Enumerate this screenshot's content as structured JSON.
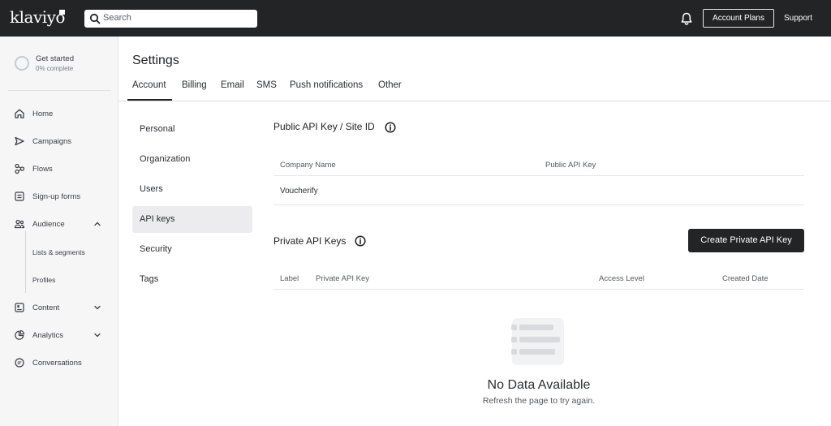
{
  "topbar": {
    "logo": "klaviyo",
    "search_placeholder": "Search",
    "account_plans": "Account Plans",
    "support": "Support"
  },
  "sidebar": {
    "get_started": {
      "title": "Get started",
      "progress": "0% complete"
    },
    "items": [
      {
        "label": "Home",
        "icon": "home-icon"
      },
      {
        "label": "Campaigns",
        "icon": "send-icon"
      },
      {
        "label": "Flows",
        "icon": "flows-icon"
      },
      {
        "label": "Sign-up forms",
        "icon": "form-icon"
      },
      {
        "label": "Audience",
        "icon": "people-icon",
        "expanded": true
      },
      {
        "label": "Content",
        "icon": "content-icon"
      },
      {
        "label": "Analytics",
        "icon": "chart-icon"
      },
      {
        "label": "Conversations",
        "icon": "chat-icon"
      }
    ],
    "audience_sub": [
      "Lists & segments",
      "Profiles"
    ]
  },
  "header": {
    "title": "Settings",
    "tabs": [
      "Account",
      "Billing",
      "Email",
      "SMS",
      "Push notifications",
      "Other"
    ],
    "active_tab": "Account"
  },
  "subnav": {
    "items": [
      "Personal",
      "Organization",
      "Users",
      "API keys",
      "Security",
      "Tags"
    ],
    "active": "API keys"
  },
  "public_api": {
    "title": "Public API Key / Site ID",
    "columns": [
      "Company Name",
      "Public API Key"
    ],
    "rows": [
      {
        "company": "Voucherify",
        "key": ""
      }
    ]
  },
  "private_api": {
    "title": "Private API Keys",
    "create_button": "Create Private API Key",
    "columns": [
      "Label",
      "Private API Key",
      "Access Level",
      "Created Date"
    ],
    "empty_title": "No Data Available",
    "empty_sub": "Refresh the page to try again."
  }
}
